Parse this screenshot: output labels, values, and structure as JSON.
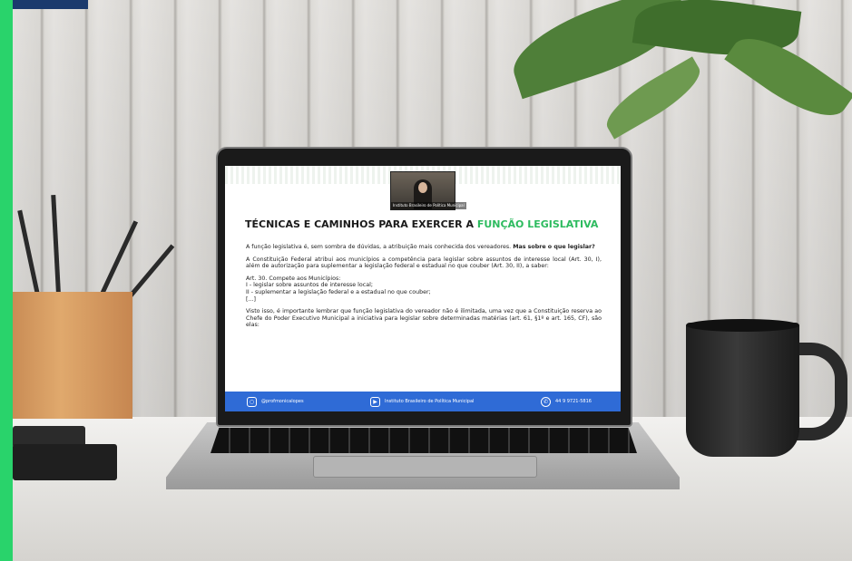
{
  "slide": {
    "video_label": "Instituto Brasileiro de Política Municipal",
    "title_main": "TÉCNICAS E CAMINHOS PARA EXERCER A",
    "title_accent": "FUNÇÃO LEGISLATIVA",
    "para1_normal": "A função legislativa é, sem sombra de dúvidas, a atribuição mais conhecida dos vereadores.",
    "para1_bold": "Mas sobre o que legislar?",
    "para2": "A Constituição Federal atribui aos municípios a competência para legislar sobre assuntos de interesse local (Art. 30, I), além de autorização para suplementar a legislação federal e estadual no que couber (Art. 30, II), a saber:",
    "art_lines": [
      "Art. 30. Compete aos Municípios:",
      "I - legislar sobre assuntos de interesse local;",
      "II - suplementar a legislação federal e a estadual no que couber;",
      "[...]"
    ],
    "para4": "Visto isso, é importante lembrar que função legislativa do vereador não é ilimitada, uma vez que a Constituição reserva ao Chefe do Poder Executivo Municipal a iniciativa para legislar sobre determinadas matérias (art. 61, §1º e art. 165, CF), são elas:",
    "footer": {
      "instagram": "@profmonicalopes",
      "youtube": "Instituto Brasileiro de Política Municipal",
      "whatsapp": "44 9 9721-5816"
    }
  },
  "colors": {
    "accent_green": "#2dbb5f",
    "footer_blue": "#2f6bd6",
    "side_bar_green": "#29d36b",
    "top_tab_blue": "#1b3a6d"
  },
  "icons": [
    "instagram-icon",
    "youtube-icon",
    "whatsapp-icon"
  ]
}
